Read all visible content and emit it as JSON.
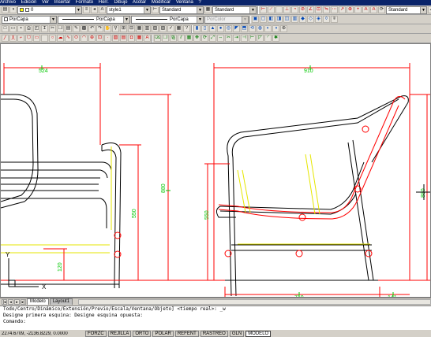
{
  "menu": {
    "items": [
      "Archivo",
      "Edición",
      "Ver",
      "Insertar",
      "Formato",
      "Herr.",
      "Dibujo",
      "Acotar",
      "Modificar",
      "Ventana",
      "?"
    ]
  },
  "layers": {
    "current_layer": "0"
  },
  "styles": {
    "text_style": "style1",
    "dim_style": "Standard",
    "table_style": "Standard",
    "plot_style": "Standard"
  },
  "properties": {
    "color": "PorCapa",
    "linetype": "PorCapa",
    "lineweight": "PorCapa",
    "plotstyle": "PorColor"
  },
  "dimensions": {
    "front_width": "524",
    "front_height": "880",
    "front_seat_height": "550",
    "front_base": "120",
    "side_width": "910",
    "side_height": "880",
    "side_seat_height": "550",
    "side_seat_depth": "719",
    "side_rear": "141"
  },
  "ucs": {
    "y_label": "Y",
    "x_label": "X"
  },
  "tabs": {
    "model": "Modelo",
    "layout": "Layout1"
  },
  "command": {
    "line1": "Todo/Centro/Dinámico/Extensión/Previo/Escala/Ventana/Objeto] <tiempo real>: _w",
    "line2": "Designe primera esquina: Designe esquina opuesta:",
    "prompt": "Comando:"
  },
  "status": {
    "coordinates": "2274.6709, -2136.8229, 0.0000",
    "buttons": [
      "FORZC",
      "REJILLA",
      "ORTO",
      "POLAR",
      "REFENT",
      "RASTREO",
      "GLN",
      "MODELO"
    ]
  },
  "colors": {
    "dimension": "#ff0000",
    "dimension_text": "#00c800",
    "object": "#000000",
    "hidden": "#e6e600",
    "background": "#ffffff"
  }
}
